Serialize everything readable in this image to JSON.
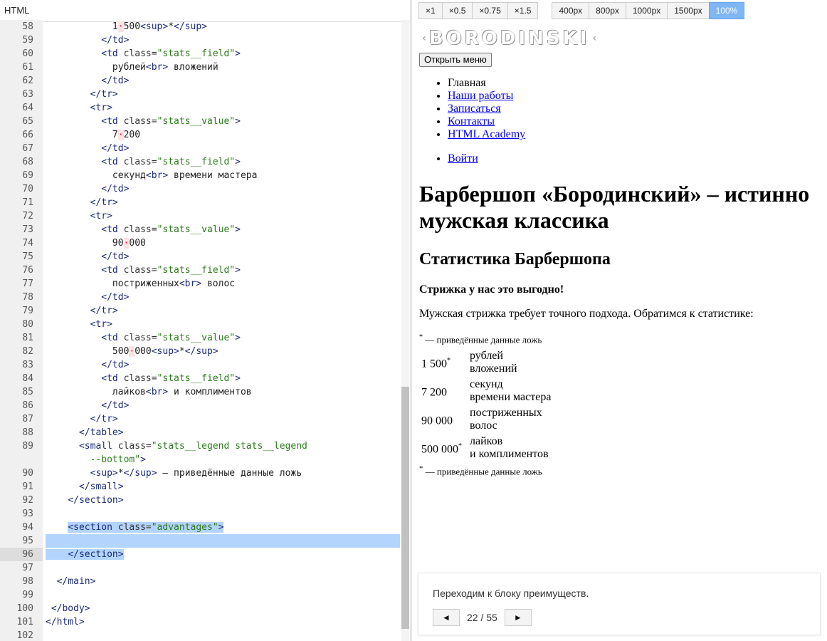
{
  "editor": {
    "tab_label": "HTML",
    "lines": [
      {
        "n": "58",
        "html": "            1<span class=\"dot\">·</span>500<span class=\"t\">&lt;sup&gt;</span>*<span class=\"t\">&lt;/sup&gt;</span>"
      },
      {
        "n": "59",
        "html": "          <span class=\"t\">&lt;/td&gt;</span>"
      },
      {
        "n": "60",
        "html": "          <span class=\"t\">&lt;td</span> <span class=\"a\">class=</span><span class=\"s\">\"stats__field\"</span><span class=\"t\">&gt;</span>"
      },
      {
        "n": "61",
        "html": "            рублей<span class=\"t\">&lt;br&gt;</span> вложений"
      },
      {
        "n": "62",
        "html": "          <span class=\"t\">&lt;/td&gt;</span>"
      },
      {
        "n": "63",
        "html": "        <span class=\"t\">&lt;/tr&gt;</span>"
      },
      {
        "n": "64",
        "html": "        <span class=\"t\">&lt;tr&gt;</span>"
      },
      {
        "n": "65",
        "html": "          <span class=\"t\">&lt;td</span> <span class=\"a\">class=</span><span class=\"s\">\"stats__value\"</span><span class=\"t\">&gt;</span>"
      },
      {
        "n": "66",
        "html": "            7<span class=\"dot\">·</span>200"
      },
      {
        "n": "67",
        "html": "          <span class=\"t\">&lt;/td&gt;</span>"
      },
      {
        "n": "68",
        "html": "          <span class=\"t\">&lt;td</span> <span class=\"a\">class=</span><span class=\"s\">\"stats__field\"</span><span class=\"t\">&gt;</span>"
      },
      {
        "n": "69",
        "html": "            секунд<span class=\"t\">&lt;br&gt;</span> времени мастера"
      },
      {
        "n": "70",
        "html": "          <span class=\"t\">&lt;/td&gt;</span>"
      },
      {
        "n": "71",
        "html": "        <span class=\"t\">&lt;/tr&gt;</span>"
      },
      {
        "n": "72",
        "html": "        <span class=\"t\">&lt;tr&gt;</span>"
      },
      {
        "n": "73",
        "html": "          <span class=\"t\">&lt;td</span> <span class=\"a\">class=</span><span class=\"s\">\"stats__value\"</span><span class=\"t\">&gt;</span>"
      },
      {
        "n": "74",
        "html": "            90<span class=\"dot\">·</span>000"
      },
      {
        "n": "75",
        "html": "          <span class=\"t\">&lt;/td&gt;</span>"
      },
      {
        "n": "76",
        "html": "          <span class=\"t\">&lt;td</span> <span class=\"a\">class=</span><span class=\"s\">\"stats__field\"</span><span class=\"t\">&gt;</span>"
      },
      {
        "n": "77",
        "html": "            постриженных<span class=\"t\">&lt;br&gt;</span> волос"
      },
      {
        "n": "78",
        "html": "          <span class=\"t\">&lt;/td&gt;</span>"
      },
      {
        "n": "79",
        "html": "        <span class=\"t\">&lt;/tr&gt;</span>"
      },
      {
        "n": "80",
        "html": "        <span class=\"t\">&lt;tr&gt;</span>"
      },
      {
        "n": "81",
        "html": "          <span class=\"t\">&lt;td</span> <span class=\"a\">class=</span><span class=\"s\">\"stats__value\"</span><span class=\"t\">&gt;</span>"
      },
      {
        "n": "82",
        "html": "            500<span class=\"dot\">·</span>000<span class=\"t\">&lt;sup&gt;</span>*<span class=\"t\">&lt;/sup&gt;</span>"
      },
      {
        "n": "83",
        "html": "          <span class=\"t\">&lt;/td&gt;</span>"
      },
      {
        "n": "84",
        "html": "          <span class=\"t\">&lt;td</span> <span class=\"a\">class=</span><span class=\"s\">\"stats__field\"</span><span class=\"t\">&gt;</span>"
      },
      {
        "n": "85",
        "html": "            лайков<span class=\"t\">&lt;br&gt;</span> и комплиментов"
      },
      {
        "n": "86",
        "html": "          <span class=\"t\">&lt;/td&gt;</span>"
      },
      {
        "n": "87",
        "html": "        <span class=\"t\">&lt;/tr&gt;</span>"
      },
      {
        "n": "88",
        "html": "      <span class=\"t\">&lt;/table&gt;</span>"
      },
      {
        "n": "89",
        "wrap": true,
        "html": "      <span class=\"t\">&lt;small</span> <span class=\"a\">class=</span><span class=\"s\">\"stats__legend stats__legend\n        --bottom\"</span><span class=\"t\">&gt;</span>"
      },
      {
        "n": "90",
        "html": "        <span class=\"t\">&lt;sup&gt;</span>*<span class=\"t\">&lt;/sup&gt;</span> — приведённые данные ложь"
      },
      {
        "n": "91",
        "html": "      <span class=\"t\">&lt;/small&gt;</span>"
      },
      {
        "n": "92",
        "html": "    <span class=\"t\">&lt;/section&gt;</span>"
      },
      {
        "n": "93",
        "html": ""
      },
      {
        "n": "94",
        "selpart": true,
        "html": "    <span class=\"hl\"><span class=\"t\">&lt;section</span> <span class=\"a\">class=</span><span class=\"s\">\"advantages\"</span><span class=\"t\">&gt;</span></span>"
      },
      {
        "n": "95",
        "sel": true,
        "html": " "
      },
      {
        "n": "96",
        "cur": true,
        "selpart": true,
        "html": "<span class=\"hl\">    <span class=\"t\">&lt;/section&gt;</span></span>"
      },
      {
        "n": "97",
        "html": ""
      },
      {
        "n": "98",
        "html": "  <span class=\"t\">&lt;/main&gt;</span>"
      },
      {
        "n": "99",
        "html": ""
      },
      {
        "n": "100",
        "html": " <span class=\"t\">&lt;/body&gt;</span>"
      },
      {
        "n": "101",
        "html": "<span class=\"t\">&lt;/html&gt;</span>"
      },
      {
        "n": "102",
        "html": ""
      }
    ]
  },
  "toolbar": {
    "scale_buttons": [
      "×1",
      "×0.5",
      "×0.75",
      "×1.5"
    ],
    "width_buttons": [
      "400px",
      "800px",
      "1000px",
      "1500px",
      "100%"
    ],
    "active_width": "100%"
  },
  "preview": {
    "logo_text": "BORODINSKI",
    "menu_button": "Открыть меню",
    "nav_items": [
      {
        "label": "Главная",
        "link": false
      },
      {
        "label": "Наши работы",
        "link": true
      },
      {
        "label": "Записаться",
        "link": true
      },
      {
        "label": "Контакты",
        "link": true
      },
      {
        "label": "HTML Academy",
        "link": true
      }
    ],
    "login_link": "Войти",
    "h1": "Барбершоп «Бородинский» – истинно мужская классика",
    "h2": "Статистика Барбершопа",
    "p_bold": "Стрижка у нас это выгодно!",
    "p_text": "Мужская стрижка требует точного подхода. Обратимся к статистике:",
    "legend_star": "*",
    "legend_text": " — приведённые данные ложь",
    "stats": [
      {
        "value": "1 500",
        "star": "*",
        "field1": "рублей",
        "field2": "вложений"
      },
      {
        "value": "7 200",
        "star": "",
        "field1": "секунд",
        "field2": "времени мастера"
      },
      {
        "value": "90 000",
        "star": "",
        "field1": "постриженных",
        "field2": "волос"
      },
      {
        "value": "500 000",
        "star": "*",
        "field1": "лайков",
        "field2": "и комплиментов"
      }
    ]
  },
  "hint": {
    "text": "Переходим к блоку преимуществ.",
    "prev": "◄",
    "next": "►",
    "counter": "22 / 55"
  }
}
